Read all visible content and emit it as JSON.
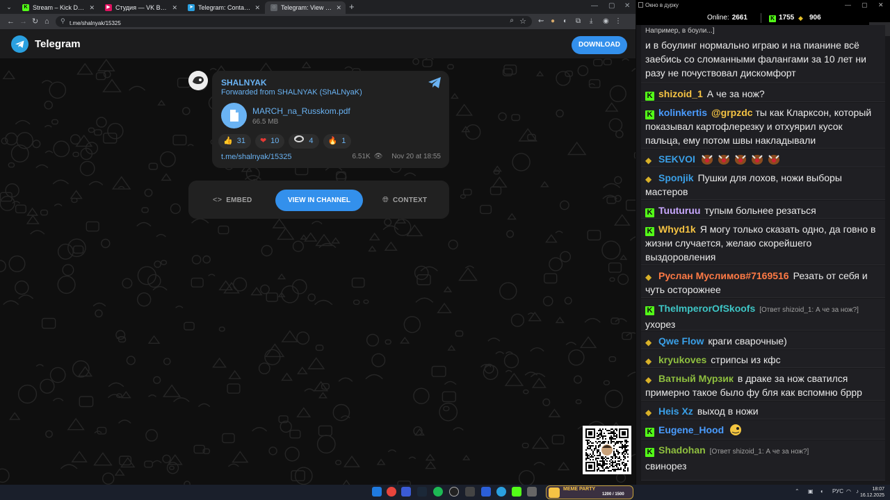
{
  "browser": {
    "tabs": [
      {
        "title": "Stream – Kick Dashboard",
        "icon": "kick-icon",
        "color": "#53fc18",
        "active": false
      },
      {
        "title": "Студия — VK Видео Live",
        "icon": "vk-live-icon",
        "color": "#e0115f",
        "active": false
      },
      {
        "title": "Telegram: Contact @Love_Russ",
        "icon": "telegram-icon",
        "color": "#2aa0e0",
        "active": false
      },
      {
        "title": "Telegram: View @shalnyak",
        "icon": "telegram-icon",
        "color": "#9aa0a6",
        "active": true
      }
    ],
    "url": "t.me/shalnyak/15325"
  },
  "telegram": {
    "brand": "Telegram",
    "download_label": "DOWNLOAD",
    "post": {
      "channel": "SHALNYAK",
      "forwarded_prefix": "Forwarded from",
      "forwarded_from": "SHALNYAK (ShALNyaK)",
      "file": {
        "name": "MARCH_na_Russkom.pdf",
        "size": "66.5 MB"
      },
      "reactions": [
        {
          "emoji": "👍",
          "icon": "thumbs-up-icon",
          "count": "31"
        },
        {
          "emoji": "❤",
          "icon": "heart-icon",
          "count": "10"
        },
        {
          "emoji": "",
          "icon": "custom-emoji-icon",
          "count": "4"
        },
        {
          "emoji": "🔥",
          "icon": "fire-icon",
          "count": "1"
        }
      ],
      "link": "t.me/shalnyak/15325",
      "views": "6.51K",
      "date": "Nov 20 at 18:55"
    },
    "actions": {
      "embed": "EMBED",
      "view_in_channel": "VIEW IN CHANNEL",
      "context": "CONTEXT"
    }
  },
  "chat": {
    "window_title": "Окно в дурку",
    "online_label": "Online:",
    "online_count": "2661",
    "kick_count": "1755",
    "vk_count": "906",
    "messages": [
      {
        "platform": "",
        "nick": "",
        "nick_color": "",
        "reply": "",
        "quote": "Например, в боули...]",
        "text": "и в боулинг нормально играю и на пианине всё заебись со сломанными фалангами за 10 лет ни разу не почуствовал дискомфорт"
      },
      {
        "platform": "kick",
        "nick": "shizoid_1",
        "nick_color": "#f5c343",
        "reply": "",
        "text": "А че за нож?"
      },
      {
        "platform": "kick",
        "nick": "kolinkertis",
        "nick_color": "#4a9cff",
        "reply": "",
        "mention": "@grpzdc",
        "text": "ты как Кларксон, который показывал картофлерезку и отхуярил кусок пальца, ему потом швы накладывали"
      },
      {
        "platform": "vk",
        "nick": "SEKVOI",
        "nick_color": "#3aa0e8",
        "reply": "",
        "text": "",
        "emotes": 5
      },
      {
        "platform": "vk",
        "nick": "Sponjik",
        "nick_color": "#3aa0e8",
        "reply": "",
        "text": "Пушки для лохов, ножи выборы мастеров"
      },
      {
        "platform": "kick",
        "nick": "Tuuturuu",
        "nick_color": "#c8a8ff",
        "reply": "",
        "text": "тупым больнее резаться"
      },
      {
        "platform": "kick",
        "nick": "Whyd1k",
        "nick_color": "#f5c343",
        "reply": "",
        "text": "Я могу только сказать одно, да говно в жизни случается, желаю скорейшего выздоровления"
      },
      {
        "platform": "vk",
        "nick": "Руслан Муслимов#7169516",
        "nick_color": "#ff7a45",
        "reply": "",
        "text": "Резать от себя и чуть осторожнее"
      },
      {
        "platform": "kick",
        "nick": "TheImperorOfSkoofs",
        "nick_color": "#3ec6c6",
        "reply": "[Ответ shizoid_1: А че за нож?]",
        "text": "ухорез"
      },
      {
        "platform": "vk",
        "nick": "Qwe Flow",
        "nick_color": "#3aa0e8",
        "reply": "",
        "text": "краги сварочные)"
      },
      {
        "platform": "vk",
        "nick": "kryukoves",
        "nick_color": "#8fbf3f",
        "reply": "",
        "text": "стрипсы из кфс"
      },
      {
        "platform": "vk",
        "nick": "Ватный Мурзик",
        "nick_color": "#8fbf3f",
        "reply": "",
        "text": "в драке за нож сватился примерно такое было фу бля как вспомню бррр"
      },
      {
        "platform": "vk",
        "nick": "Heis Xz",
        "nick_color": "#3aa0e8",
        "reply": "",
        "text": "выход в ножи"
      },
      {
        "platform": "kick",
        "nick": "Eugene_Hood",
        "nick_color": "#4a9cff",
        "reply": "",
        "text": "",
        "emotes": 1
      },
      {
        "platform": "kick",
        "nick": "Shadohan",
        "nick_color": "#8fbf3f",
        "reply": "[Ответ shizoid_1: А че за нож?]",
        "text": "свинорез"
      }
    ]
  },
  "taskbar": {
    "widget_title": "MEME PARTY",
    "widget_value": "1200 / 1500",
    "lang": "РУС",
    "time": "18:07",
    "date": "16.12.2025"
  }
}
